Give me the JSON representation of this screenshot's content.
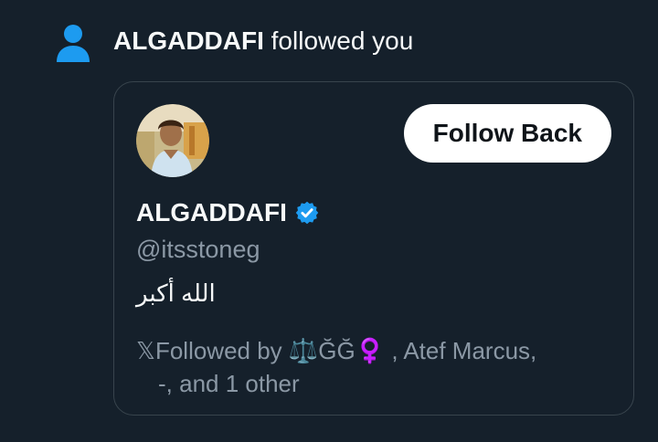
{
  "notification": {
    "actor_name": "ALGADDAFI",
    "action_text": "followed you"
  },
  "card": {
    "follow_button_label": "Follow Back",
    "display_name": "ALGADDAFI",
    "handle": "@itsstoneg",
    "bio": "الله أكبر",
    "followed_by_line1": "𝕏Followed by ⚖️ĞĞ♀️ , Atef Marcus,",
    "followed_by_line2": "-, and 1 other"
  },
  "colors": {
    "background": "#15202b",
    "accent": "#1d9bf0",
    "border": "#38444d",
    "muted_text": "#8b98a5",
    "button_bg": "#ffffff"
  },
  "icons": {
    "notification_icon": "person-icon",
    "verified": "verified-badge-icon"
  }
}
